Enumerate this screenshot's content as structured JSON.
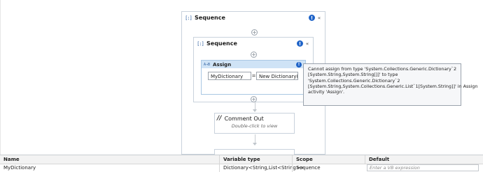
{
  "outer_sequence": {
    "title": "Sequence",
    "warning": "!",
    "collapse": "«"
  },
  "inner_sequence": {
    "title": "Sequence",
    "warning": "!",
    "collapse": "«"
  },
  "assign": {
    "title": "Assign",
    "warning": "!",
    "to_value": "MyDictionary",
    "equals": "=",
    "value_expr": "New Dictionary(Of"
  },
  "tooltip": {
    "lines": [
      "Cannot assign from type 'System.Collections.Generic.Dictionary`2",
      "[System.String,System.String[]]' to type",
      "'System.Collections.Generic.Dictionary`2",
      "[System.String,System.Collections.Generic.List`1[System.String]]' in Assign",
      "activity 'Assign'."
    ]
  },
  "comment_out": {
    "title": "Comment Out",
    "hint": "Double-click to view"
  },
  "variables": {
    "headers": {
      "name": "Name",
      "type": "Variable type",
      "scope": "Scope",
      "default": "Default"
    },
    "rows": [
      {
        "name": "MyDictionary",
        "type": "Dictionary<String,List<String>>",
        "scope": "Sequence",
        "default_placeholder": "Enter a VB expression"
      }
    ]
  },
  "icons": {
    "sequence": "sequence-icon",
    "assign": "assign-icon",
    "comment": "comment-out-icon",
    "warning": "warning-icon",
    "collapse": "collapse-icon",
    "add": "add-activity-icon"
  }
}
